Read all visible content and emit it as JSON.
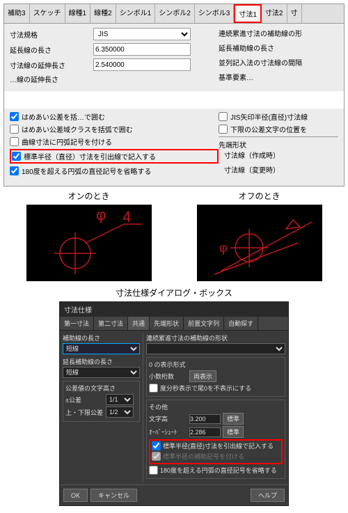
{
  "top_dialog": {
    "tabs": [
      "補助3",
      "スケッチ",
      "線種1",
      "線種2",
      "シンボル1",
      "シンボル2",
      "シンボル3",
      "寸法1",
      "寸法2",
      "寸"
    ],
    "active_tab_index": 7,
    "fields": {
      "dim_standard_label": "寸法規格",
      "dim_standard_value": "JIS",
      "ext_len_label": "延長線の長さ",
      "ext_len_value": "6.350000",
      "dim_ext_label": "寸法線の延伸長さ",
      "dim_ext_value": "2.540000",
      "partial_label": "…線の延伸長さ"
    },
    "right_labels": {
      "r1": "連続累進寸法の補助線の形",
      "r2": "延長補助線の長さ",
      "r3": "並列記入法の寸法線の間隔",
      "r4": "基準要素…"
    },
    "checkboxes": {
      "c1": "はめあい公差を括…で囲む",
      "c2": "はめあい公差域クラスを括弧で囲む",
      "c3": "曲線寸法に円弧記号を付ける",
      "c4": "標準半径（直径）寸法を引出線で記入する",
      "c5": "180度を超える円弧の直径記号を省略する"
    },
    "right_checks": {
      "rc1": "JIS矢印半径(直径)寸法線",
      "rc2": "下限の公差文字の位置を",
      "group": "先端形状",
      "g1": "寸法線（作成時）",
      "g2": "寸法線（変更時）"
    }
  },
  "previews": {
    "on_label": "オンのとき",
    "off_label": "オフのとき"
  },
  "bottom_dialog": {
    "caption": "寸法仕様ダイアログ・ボックス",
    "title": "寸法仕様",
    "tabs": [
      "第一寸法",
      "第二寸法",
      "共通",
      "先端形状",
      "前置文字列",
      "自動探す"
    ],
    "active_tab_index": 2,
    "left": {
      "aux_len_label": "補助線の長さ",
      "aux_len_value": "短線",
      "ext_aux_label": "延長補助線の長さ",
      "ext_aux_value": "短線",
      "tol_height_label": "公差値の文字高さ",
      "pm_label": "±公差",
      "pm_value": "1/1",
      "ul_label": "上・下限公差",
      "ul_value": "1/2"
    },
    "right": {
      "chain_label": "連続累進寸法の補助線の形状",
      "chain_value": "",
      "zero_group": "0 の表示形式",
      "decimals_label": "小数桁数",
      "decimals_btn": "両表示",
      "dms_check": "度分秒表示で尾0を不表示にする",
      "other_group": "その他",
      "char_h_label": "文字高",
      "char_h_value": "3.200",
      "char_h_btn": "標準",
      "overshoot_label": "ｵｰﾊﾞｰｼｭｰﾄ",
      "overshoot_value": "2.286",
      "overshoot_btn": "標準",
      "hl_check": "標準半径(直径)寸法を引出線で記入する",
      "dim_check": "標準半径の補助記号を付ける",
      "arc_check": "180度を超える円弧の直径記号を省略する"
    },
    "buttons": {
      "ok": "OK",
      "cancel": "キャンセル",
      "help": "ヘルプ"
    }
  }
}
